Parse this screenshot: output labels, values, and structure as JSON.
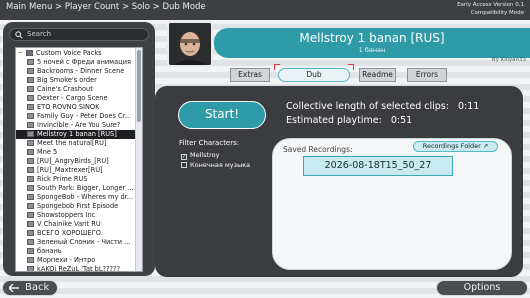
{
  "topbar": {
    "breadcrumb": "Main Menu > Player Count > Solo > Dub Mode",
    "version_line1": "Early Access Version 0.1",
    "version_line2": "Compatibility Mode"
  },
  "search": {
    "placeholder": "Search"
  },
  "tree": {
    "root": "Custom Voice Packs",
    "items": [
      "5 ночей с Фреди анимация",
      "Backrooms - Dinner Scene",
      "Big Smoke's order",
      "Caine's Crashout",
      "Dexter - Cargo Scene",
      "ETO ROVNO SINOK",
      "Family Guy - Peter Does Cr...",
      "Invincible - Are You Sure?",
      "Mellstroy 1 banan [RUS]",
      "Meet the natural[RU]",
      "Mne 5",
      "[RU]_AngryBirds_[RU]",
      "[RU]_Maxtrexer[RU]",
      "Rick Prime RUS",
      "South Park: Bigger, Longer ...",
      "SpongeBob - Wheres my dr...",
      "Spongebob First Episode",
      "Showstoppers Inc",
      "V Chainike Varit RU",
      "ВСЕГО ХОРОШЕГО.",
      "Зеленый Слоник - Чисти ...",
      "банань",
      "Морпехи - Интро",
      "kAKOj ReZuL 'Tat bL?????"
    ],
    "selected_index": 8
  },
  "header": {
    "title": "Mellstroy 1 banan [RUS]",
    "subtitle": "1 банан",
    "author": "By Killyan33"
  },
  "tabs": [
    "Extras",
    "Dub",
    "Readme",
    "Errors"
  ],
  "active_tab": "Dub",
  "main": {
    "start_label": "Start!",
    "collective_label": "Collective length of selected clips:",
    "collective_value": "0:11",
    "playtime_label": "Estimated playtime:",
    "playtime_value": "0:51",
    "filter_label": "Filter Characters:",
    "characters": [
      {
        "name": "Mellstroy",
        "checked": true
      },
      {
        "name": "Конечная музыка",
        "checked": false
      }
    ],
    "saved_label": "Saved Recordings:",
    "folder_button": "Recordings Folder ↗",
    "recordings": [
      "2026-08-18T15_50_27"
    ]
  },
  "footer": {
    "back_label": "Back",
    "options_label": "Options"
  },
  "colors": {
    "accent": "#2f9ba8",
    "panel": "#3a3c40",
    "topbar": "#3d3f43"
  }
}
